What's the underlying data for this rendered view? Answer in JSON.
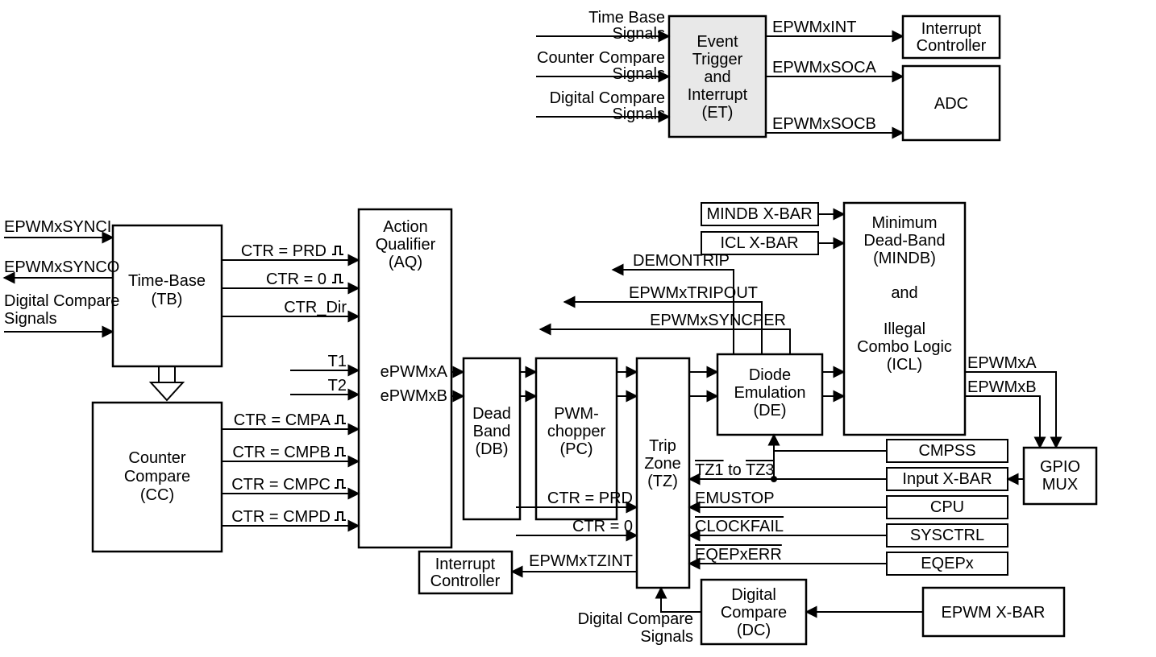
{
  "top": {
    "in": [
      "Time Base",
      "Signals",
      "Counter Compare",
      "Signals",
      "Digital Compare",
      "Signals"
    ],
    "et": [
      "Event",
      "Trigger",
      "and",
      "Interrupt",
      "(ET)"
    ],
    "out": [
      "EPWMxINT",
      "EPWMxSOCA",
      "EPWMxSOCB"
    ],
    "ic": [
      "Interrupt",
      "Controller"
    ],
    "adc": "ADC"
  },
  "left": {
    "synci": "EPWMxSYNCI",
    "synco": "EPWMxSYNCO",
    "dcs": [
      "Digital Compare",
      "Signals"
    ],
    "tb": [
      "Time-Base",
      "(TB)"
    ],
    "cc": [
      "Counter",
      "Compare",
      "(CC)"
    ],
    "ctrprd": "CTR = PRD",
    "ctr0": "CTR = 0",
    "ctrdir": "CTR_Dir",
    "t1": "T1",
    "t2": "T2",
    "cmpa": "CTR = CMPA",
    "cmpb": "CTR = CMPB",
    "cmpc": "CTR = CMPC",
    "cmpd": "CTR = CMPD"
  },
  "aq": {
    "title": [
      "Action",
      "Qualifier",
      "(AQ)"
    ],
    "a": "ePWMxA",
    "b": "ePWMxB"
  },
  "db": [
    "Dead",
    "Band",
    "(DB)"
  ],
  "pc": [
    "PWM-",
    "chopper",
    "(PC)"
  ],
  "tz": {
    "title": [
      "Trip",
      "Zone",
      "(TZ)"
    ],
    "ctrprd": "CTR = PRD",
    "ctr0": "CTR = 0",
    "tzint": "EPWMxTZINT",
    "ic": [
      "Interrupt",
      "Controller"
    ]
  },
  "de": {
    "title": [
      "Diode",
      "Emulation",
      "(DE)"
    ],
    "demon": "DEMONTRIP",
    "tripout": "EPWMxTRIPOUT",
    "syncper": "EPWMxSYNCPER"
  },
  "mindb": {
    "mindb": "MINDB X-BAR",
    "icl": "ICL X-BAR",
    "title": [
      "Minimum",
      "Dead-Band",
      "(MINDB)",
      "",
      "and",
      "",
      "Illegal",
      "Combo Logic",
      "(ICL)"
    ]
  },
  "out": {
    "a": "EPWMxA",
    "b": "EPWMxB"
  },
  "rboxes": {
    "cmpss": "CMPSS",
    "ixbar": "Input X-BAR",
    "cpu": "CPU",
    "sysctrl": "SYSCTRL",
    "eqep": "EQEPx"
  },
  "rsig": {
    "tz": "TZ1",
    "tz2": " to ",
    "tz3": "TZ3",
    "emu": "EMUSTOP",
    "clk": "CLOCKFAIL",
    "eqep": "EQEPxERR"
  },
  "gpio": [
    "GPIO",
    "MUX"
  ],
  "dc": {
    "title": [
      "Digital",
      "Compare",
      "(DC)"
    ],
    "sig": [
      "Digital Compare",
      "Signals"
    ],
    "xbar": "EPWM X-BAR"
  }
}
